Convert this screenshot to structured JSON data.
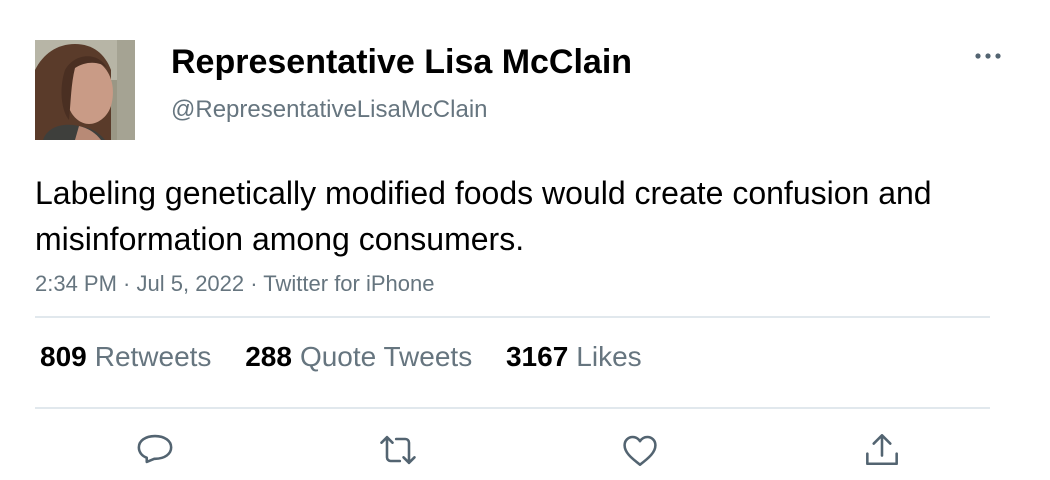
{
  "author": {
    "display_name": "Representative Lisa McClain",
    "handle": "@RepresentativeLisaMcClain"
  },
  "tweet": {
    "text": "Labeling genetically modified foods would create confusion and misinformation among consumers.",
    "time": "2:34 PM",
    "date": "Jul 5, 2022",
    "source": "Twitter for iPhone",
    "separator": " · "
  },
  "stats": [
    {
      "count": "809",
      "label": "Retweets"
    },
    {
      "count": "288",
      "label": "Quote Tweets"
    },
    {
      "count": "3167",
      "label": "Likes"
    }
  ],
  "icons": {
    "more": "more-horizontal-icon",
    "reply": "reply-icon",
    "retweet": "retweet-icon",
    "like": "like-icon",
    "share": "share-icon"
  },
  "colors": {
    "secondary_text": "#66757f",
    "icon": "#536471",
    "divider": "#e1e8ed"
  }
}
